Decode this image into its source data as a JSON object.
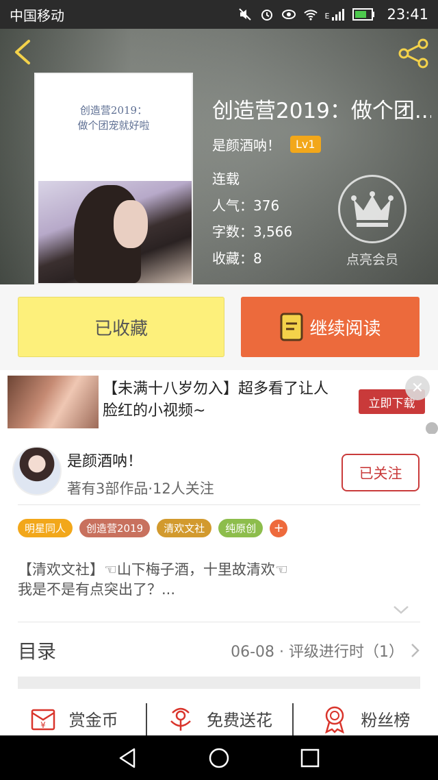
{
  "status_bar": {
    "carrier": "中国移动",
    "time": "23:41",
    "network": "E"
  },
  "book": {
    "cover_text_1": "创造营2019：",
    "cover_text_2": "做个团宠就好啦",
    "title": "创造营2019：做个团...",
    "author": "是颜酒呐！",
    "level": "Lv1",
    "status": "连载",
    "popularity": "人气：376",
    "word_count": "字数：3,566",
    "favorites": "收藏：8",
    "vip_label": "点亮会员"
  },
  "actions": {
    "favorited_label": "已收藏",
    "continue_label": "继续阅读"
  },
  "ad": {
    "text": "【未满十八岁勿入】超多看了让人脸红的小视频~",
    "button_label": "立即下载",
    "close_glyph": "✕"
  },
  "author_card": {
    "name": "是颜酒呐！",
    "stats": "著有3部作品·12人关注",
    "follow_label": "已关注"
  },
  "tags": [
    {
      "label": "明星同人",
      "color": "#f2a71a"
    },
    {
      "label": "创造营2019",
      "color": "#c8715e"
    },
    {
      "label": "清欢文社",
      "color": "#d29a2e"
    },
    {
      "label": "纯原创",
      "color": "#8dbd4c"
    }
  ],
  "tag_add": "+",
  "description": {
    "line1": "【清欢文社】☜山下梅子酒，十里故清欢☜",
    "line2": "我是不是有点突出了？..."
  },
  "catalog": {
    "label": "目录",
    "latest": "06-08 · 评级进行时（1）"
  },
  "stats_row": [
    {
      "label": "赏金币",
      "icon": "coin-envelope-icon"
    },
    {
      "label": "免费送花",
      "icon": "flower-icon"
    },
    {
      "label": "粉丝榜",
      "icon": "medal-icon"
    }
  ],
  "colors": {
    "accent_orange": "#ec6a3c",
    "fav_yellow": "#fdf07b",
    "follow_red": "#c93a3a",
    "level_badge": "#f2a71a"
  }
}
